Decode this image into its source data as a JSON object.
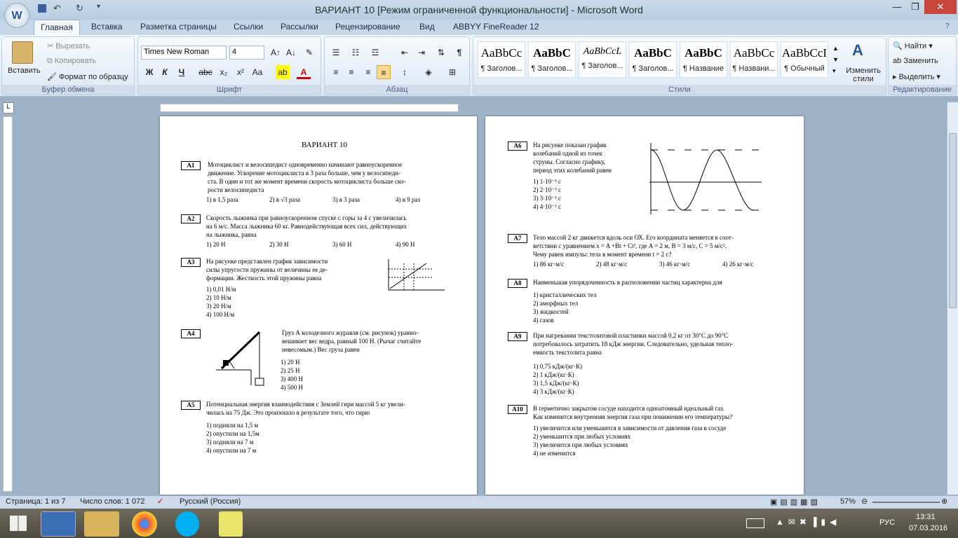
{
  "window": {
    "title": "ВАРИАНТ 10 [Режим ограниченной функциональности] - Microsoft Word"
  },
  "tabs": [
    "Главная",
    "Вставка",
    "Разметка страницы",
    "Ссылки",
    "Рассылки",
    "Рецензирование",
    "Вид",
    "ABBYY FineReader 12"
  ],
  "clipboard": {
    "paste": "Вставить",
    "cut": "Вырезать",
    "copy": "Копировать",
    "format_painter": "Формат по образцу",
    "label": "Буфер обмена"
  },
  "font": {
    "name": "Times New Roman",
    "size": "4",
    "label": "Шрифт"
  },
  "paragraph": {
    "label": "Абзац"
  },
  "styles": {
    "items": [
      {
        "preview": "AaBbCc",
        "name": "¶ Заголов..."
      },
      {
        "preview": "AaBbC",
        "name": "¶ Заголов..."
      },
      {
        "preview": "AaBbCcL",
        "name": "¶ Заголов..."
      },
      {
        "preview": "AaBbC",
        "name": "¶ Заголов..."
      },
      {
        "preview": "AaBbC",
        "name": "¶ Название"
      },
      {
        "preview": "AaBbCc",
        "name": "¶ Названи..."
      },
      {
        "preview": "AaBbCcI",
        "name": "¶ Обычный"
      }
    ],
    "change": "Изменить стили",
    "label": "Стили"
  },
  "editing": {
    "find": "Найти",
    "replace": "Заменить",
    "select": "Выделить",
    "label": "Редактирование"
  },
  "doc": {
    "title": "ВАРИАНТ 10",
    "left": [
      {
        "n": "A1",
        "lines": [
          "Мотоциклист и велосипедист одновременно начинают равноускоренное",
          "движение.  Ускорение мотоциклиста в 3 раза больше, чем у велосипеди-",
          "ста. В один и тот же момент времени скорость мотоциклиста больше ско-",
          "рости велосипедиста"
        ],
        "opts": [
          "1)  в 1,5 раза",
          "2)  в √3 раза",
          "3)  в 3 раза",
          "4)  в 9 раз"
        ]
      },
      {
        "n": "A2",
        "lines": [
          "Скорость лыжника при равноускоренном спуске с горы за 4 с увеличилась",
          "на 6 м/с. Масса лыжника 60 кг. Равнодействующая всех сил, действующих",
          "на лыжника, равна"
        ],
        "opts": [
          "1)  20 Н",
          "2)  30 Н",
          "3)  60 Н",
          "4)  90 Н"
        ]
      },
      {
        "n": "A3",
        "lines": [
          "На рисунке представлен график зависимости",
          "силы упругости пружины от величины ее де-",
          "формации. Жесткость этой пружины равна"
        ],
        "opts": [
          "1)  0,01 Н/м",
          "2)  10 Н/м",
          "3)  20 Н/м",
          "4)  100 Н/м"
        ]
      },
      {
        "n": "A4",
        "lines": [
          "Груз А колодезного журавля (см. рисунок)  уравно-",
          "вешивает вес ведра, равный 100 Н. (Рычаг считайте",
          "невесомым.) Вес груза равен"
        ],
        "opts": [
          "1)  20 Н",
          "2)  25 Н",
          "3)  400 Н",
          "4)  500 Н"
        ]
      },
      {
        "n": "A5",
        "lines": [
          "Потенциальная энергия взаимодействия с Землей гири массой 5 кг увели-",
          "чилась на 75 Дж. Это произошло в результате того, что гирю"
        ],
        "opts": [
          "1)  подняли на 1,5 м",
          "2)  опустили на 1,5м",
          "3)  подняли на 7 м",
          "4)  опустили на 7 м"
        ]
      }
    ],
    "right": [
      {
        "n": "A6",
        "lines": [
          "На  рисунке  показан  график",
          "колебаний  одной  из  точек",
          "струны.  Согласно  графику,",
          "период этих колебаний равен"
        ],
        "opts": [
          "1)  1·10⁻³ с",
          "2)  2·10⁻³ с",
          "3)  3·10⁻³ с",
          "4)  4·10⁻³ с"
        ]
      },
      {
        "n": "A7",
        "lines": [
          "Тело массой 2 кг движется вдоль оси ОХ. Его координата меняется в соот-",
          "ветствии с уравнением x = A +Bt + Ct², где A = 2 м, B = 3 м/с, C = 5 м/с².",
          "Чему равен импульс тела в момент времени t = 2 с?"
        ],
        "opts": [
          "1)  86 кг·м/с",
          "2)  48 кг·м/с",
          "3)  46 кг·м/с",
          "4)  26 кг·м/с"
        ]
      },
      {
        "n": "A8",
        "lines": [
          "Наименьшая упорядоченность в расположении частиц характерна для"
        ],
        "opts": [
          "1)  кристаллических тел",
          "2)  аморфных тел",
          "3)  жидкостей",
          "4)  газов"
        ]
      },
      {
        "n": "A9",
        "lines": [
          "При нагревании текстолитовой пластинки массой  0,2 кг  от  30°С до 90°С",
          "потребовалось затратить 18 кДж энергии. Следовательно, удельная тепло-",
          "емкость текстолита равна"
        ],
        "opts": [
          "1)  0,75 кДж/(кг·К)",
          "2)  1 кДж/(кг·К)",
          "3)  1,5 кДж/(кг·К)",
          "4)  3 кДж/(кг·К)"
        ]
      },
      {
        "n": "A10",
        "lines": [
          "В герметично закрытом сосуде находится одноатомный идеальный газ.",
          "Как изменится внутренняя энергия газа при понижении его температуры?"
        ],
        "opts": [
          "1)  увеличится или уменьшится в зависимости от давления газа в сосуде",
          "2)  уменьшится при любых условиях",
          "3)  увеличится при любых условиях",
          "4)  не изменится"
        ]
      }
    ]
  },
  "status": {
    "page": "Страница: 1 из 7",
    "words": "Число слов: 1 072",
    "lang": "Русский (Россия)",
    "zoom": "57%"
  },
  "taskbar": {
    "lang": "РУС",
    "time": "13:31",
    "date": "07.03.2016"
  }
}
